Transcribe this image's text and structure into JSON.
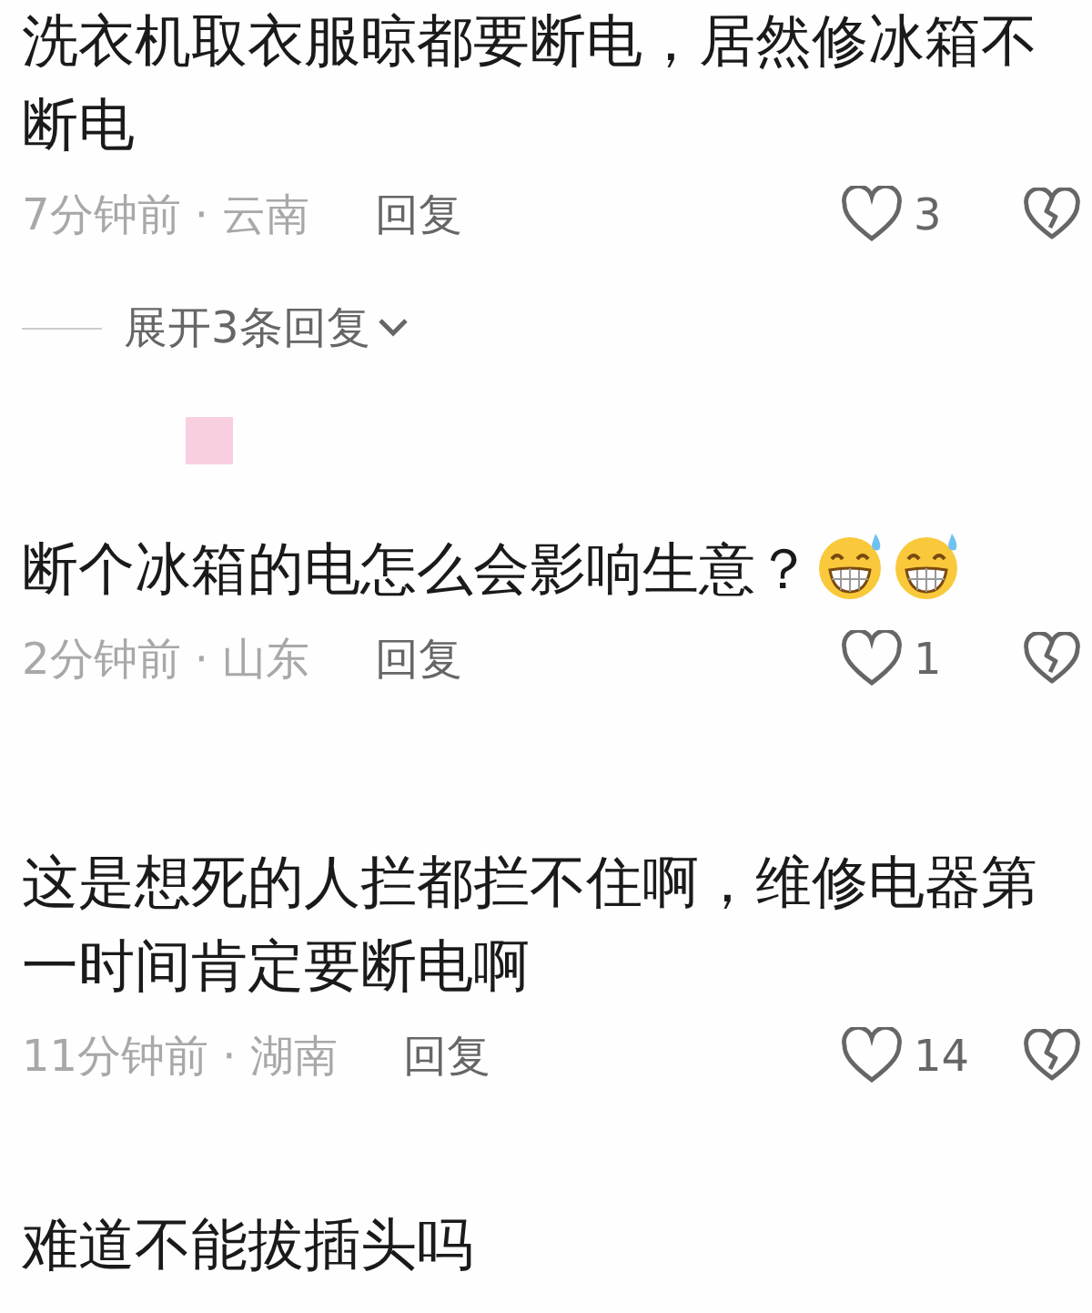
{
  "comments": [
    {
      "text": "洗衣机取衣服晾都要断电，居然修冰箱不断电",
      "meta": "7分钟前 · 云南",
      "reply": "回复",
      "likes": "3",
      "expand": {
        "label": "展开3条回复"
      }
    },
    {
      "text": "断个冰箱的电怎么会影响生意？",
      "trailing_icons": [
        {
          "kind": "grin-sweat"
        },
        {
          "kind": "grin-sweat"
        }
      ],
      "meta": "2分钟前 · 山东",
      "reply": "回复",
      "likes": "1"
    },
    {
      "text": "这是想死的人拦都拦不住啊，维修电器第一时间肯定要断电啊",
      "meta": "11分钟前 · 湖南",
      "reply": "回复",
      "likes": "14"
    },
    {
      "text": "难道不能拔插头吗"
    }
  ]
}
